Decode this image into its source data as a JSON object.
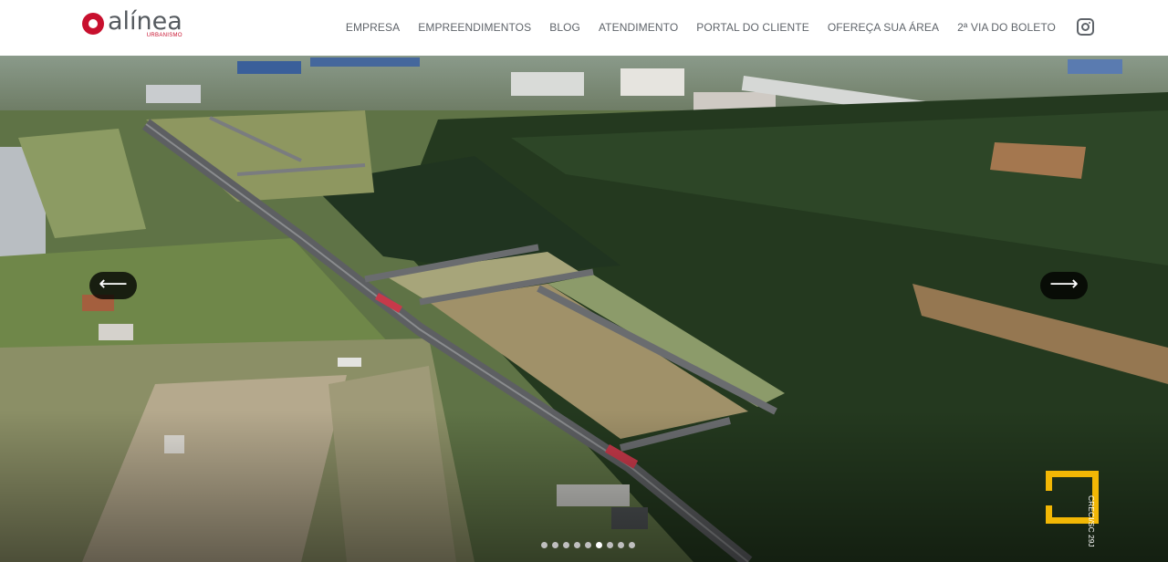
{
  "brand": {
    "name": "alínea",
    "tagline": "URBANISMO",
    "logo_color": "#c8102e"
  },
  "nav": {
    "items": [
      {
        "label": "EMPRESA"
      },
      {
        "label": "EMPREENDIMENTOS"
      },
      {
        "label": "BLOG"
      },
      {
        "label": "ATENDIMENTO"
      },
      {
        "label": "PORTAL DO CLIENTE"
      },
      {
        "label": "OFEREÇA SUA ÁREA"
      },
      {
        "label": "2ª VIA DO BOLETO"
      }
    ],
    "social_icon": "instagram-icon"
  },
  "hero": {
    "prev_icon": "arrow-left-icon",
    "prev_glyph": "⟵",
    "next_icon": "arrow-right-icon",
    "next_glyph": "⟶",
    "slide_count": 9,
    "active_slide": 6
  },
  "badge": {
    "text": "CRECI/SC 29J",
    "color": "#f2b705"
  }
}
